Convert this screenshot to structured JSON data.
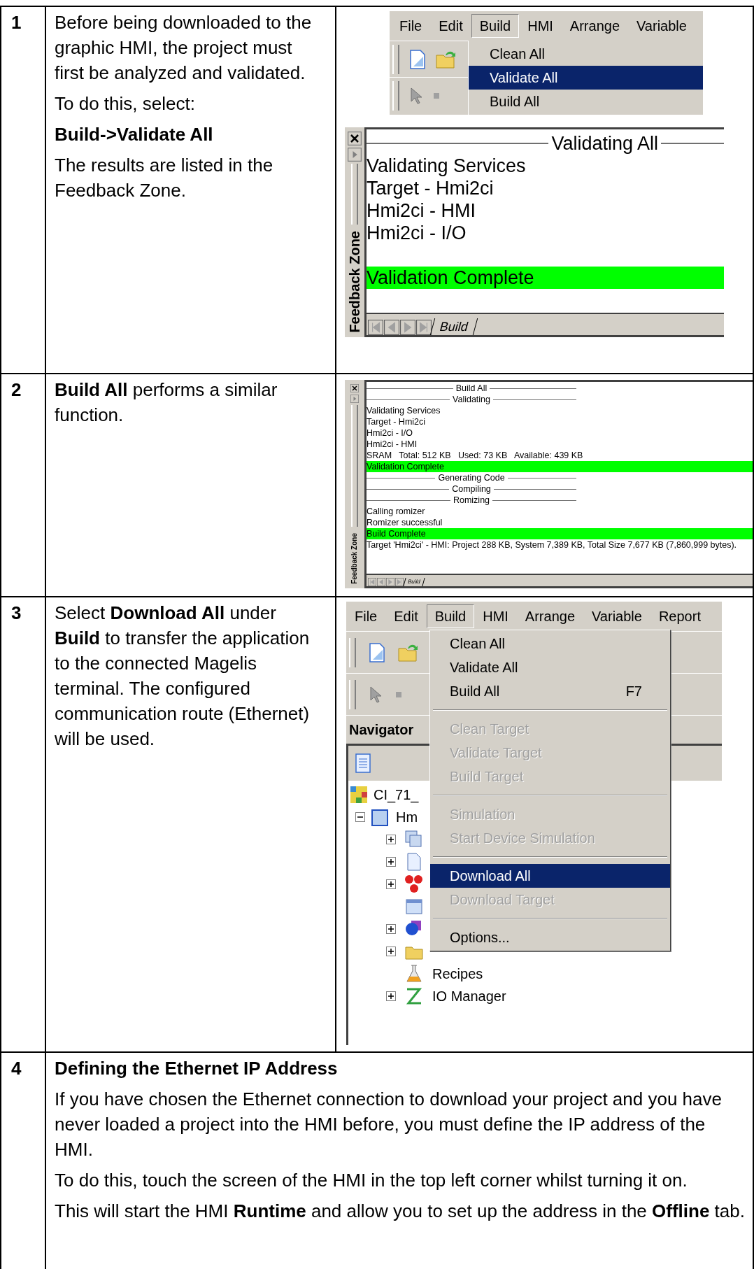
{
  "steps": [
    {
      "number": "1",
      "paragraphs": [
        {
          "text": "Before being downloaded to the graphic HMI, the project must first be analyzed and validated.",
          "bold": false
        },
        {
          "text": "To do this, select:",
          "bold": false
        },
        {
          "text": "Build->Validate All",
          "bold": true
        },
        {
          "text": "The results are listed in the Feedback Zone.",
          "bold": false
        }
      ],
      "figures": [
        {
          "kind": "menu",
          "menu_bar": [
            {
              "label": "File",
              "selected": false
            },
            {
              "label": "Edit",
              "selected": false
            },
            {
              "label": "Build",
              "selected": true
            },
            {
              "label": "HMI",
              "selected": false
            },
            {
              "label": "Arrange",
              "selected": false
            },
            {
              "label": "Variable",
              "selected": false
            }
          ],
          "menu_items": [
            {
              "kind": "item",
              "label": "Clean All",
              "selected": false,
              "disabled": false
            },
            {
              "kind": "item",
              "label": "Validate All",
              "selected": true,
              "disabled": false
            },
            {
              "kind": "item",
              "label": "Build All",
              "selected": false,
              "disabled": false
            }
          ]
        },
        {
          "kind": "feedback",
          "side_label": "Feedback Zone",
          "tab": "Build",
          "lines": [
            {
              "kind": "header",
              "text": "Validating All"
            },
            {
              "kind": "text",
              "text": "Validating Services"
            },
            {
              "kind": "text",
              "text": "Target - Hmi2ci"
            },
            {
              "kind": "text",
              "text": "Hmi2ci - HMI"
            },
            {
              "kind": "text",
              "text": "Hmi2ci - I/O"
            },
            {
              "kind": "highlight",
              "text": "Validation Complete"
            }
          ]
        }
      ]
    },
    {
      "number": "2",
      "paragraphs": [
        {
          "text": "**Build All** performs a similar function.",
          "bold": false
        }
      ],
      "figures": [
        {
          "kind": "feedback",
          "side_label": "Feedback Zone",
          "tab": "Build",
          "lines": [
            {
              "kind": "header",
              "text": "Build All"
            },
            {
              "kind": "header",
              "text": "Validating"
            },
            {
              "kind": "text",
              "text": "Validating Services"
            },
            {
              "kind": "text",
              "text": "Target - Hmi2ci"
            },
            {
              "kind": "text",
              "text": "Hmi2ci - I/O"
            },
            {
              "kind": "text",
              "text": "Hmi2ci - HMI"
            },
            {
              "kind": "text",
              "text": "SRAM   Total: 512 KB   Used: 73 KB   Available: 439 KB"
            },
            {
              "kind": "highlight",
              "text": "Validation Complete"
            },
            {
              "kind": "header",
              "text": "Generating Code"
            },
            {
              "kind": "header",
              "text": "Compiling"
            },
            {
              "kind": "header",
              "text": "Romizing"
            },
            {
              "kind": "text",
              "text": "Calling romizer"
            },
            {
              "kind": "text",
              "text": "Romizer successful"
            },
            {
              "kind": "highlight",
              "text": "Build Complete"
            },
            {
              "kind": "text",
              "text": "Target 'Hmi2ci' - HMI: Project 288 KB, System 7,389 KB, Total Size 7,677 KB (7,860,999 bytes)."
            }
          ]
        }
      ]
    },
    {
      "number": "3",
      "paragraphs": [
        {
          "text": "Select **Download All** under **Build** to transfer the application to the connected Magelis terminal. The configured communication route (Ethernet) will be used.",
          "bold": false
        }
      ],
      "figures": [
        {
          "kind": "app-window",
          "menu_bar": [
            {
              "label": "File",
              "selected": false
            },
            {
              "label": "Edit",
              "selected": false
            },
            {
              "label": "Build",
              "selected": true
            },
            {
              "label": "HMI",
              "selected": false
            },
            {
              "label": "Arrange",
              "selected": false
            },
            {
              "label": "Variable",
              "selected": false
            },
            {
              "label": "Report",
              "selected": false
            }
          ],
          "menu_items": [
            {
              "kind": "item",
              "label": "Clean All",
              "selected": false,
              "disabled": false
            },
            {
              "kind": "item",
              "label": "Validate All",
              "selected": false,
              "disabled": false
            },
            {
              "kind": "item",
              "label": "Build All",
              "shortcut": "F7",
              "selected": false,
              "disabled": false
            },
            {
              "kind": "separator"
            },
            {
              "kind": "item",
              "label": "Clean Target",
              "selected": false,
              "disabled": true
            },
            {
              "kind": "item",
              "label": "Validate Target",
              "selected": false,
              "disabled": true
            },
            {
              "kind": "item",
              "label": "Build Target",
              "selected": false,
              "disabled": true
            },
            {
              "kind": "separator"
            },
            {
              "kind": "item",
              "label": "Simulation",
              "selected": false,
              "disabled": true
            },
            {
              "kind": "item",
              "label": "Start Device Simulation",
              "selected": false,
              "disabled": true
            },
            {
              "kind": "separator"
            },
            {
              "kind": "item",
              "label": "Download All",
              "selected": true,
              "disabled": false
            },
            {
              "kind": "item",
              "label": "Download Target",
              "selected": false,
              "disabled": true
            },
            {
              "kind": "separator"
            },
            {
              "kind": "item",
              "label": "Options...",
              "selected": false,
              "disabled": false
            }
          ],
          "navigator": {
            "title": "Navigator",
            "tree": [
              {
                "kind": "project",
                "label": "CI_71_",
                "children": [
                  {
                    "kind": "target",
                    "label": "Hm",
                    "expanded": true,
                    "children": [
                      {
                        "kind": "screens",
                        "expanded": false
                      },
                      {
                        "kind": "page",
                        "expanded": false
                      },
                      {
                        "kind": "alarms",
                        "expanded": false
                      },
                      {
                        "kind": "window"
                      },
                      {
                        "kind": "text",
                        "expanded": false
                      },
                      {
                        "kind": "folder",
                        "expanded": false
                      },
                      {
                        "kind": "recipe",
                        "label": "Recipes"
                      },
                      {
                        "kind": "io",
                        "label": "IO Manager",
                        "expanded": false
                      }
                    ]
                  }
                ]
              }
            ]
          }
        }
      ]
    },
    {
      "number": "4",
      "paragraphs": [
        {
          "text": "Defining the Ethernet IP Address",
          "bold": true
        },
        {
          "text": "If you have chosen the Ethernet connection to download your project and you have never loaded a project into the HMI before, you must define the IP address of the HMI.",
          "bold": false
        },
        {
          "text": "To do this, touch the screen of the HMI in the top left corner whilst turning it on.",
          "bold": false
        },
        {
          "text": "This will start the HMI **Runtime** and allow you to set up the address in the **Offline** tab.",
          "bold": false
        }
      ]
    }
  ]
}
